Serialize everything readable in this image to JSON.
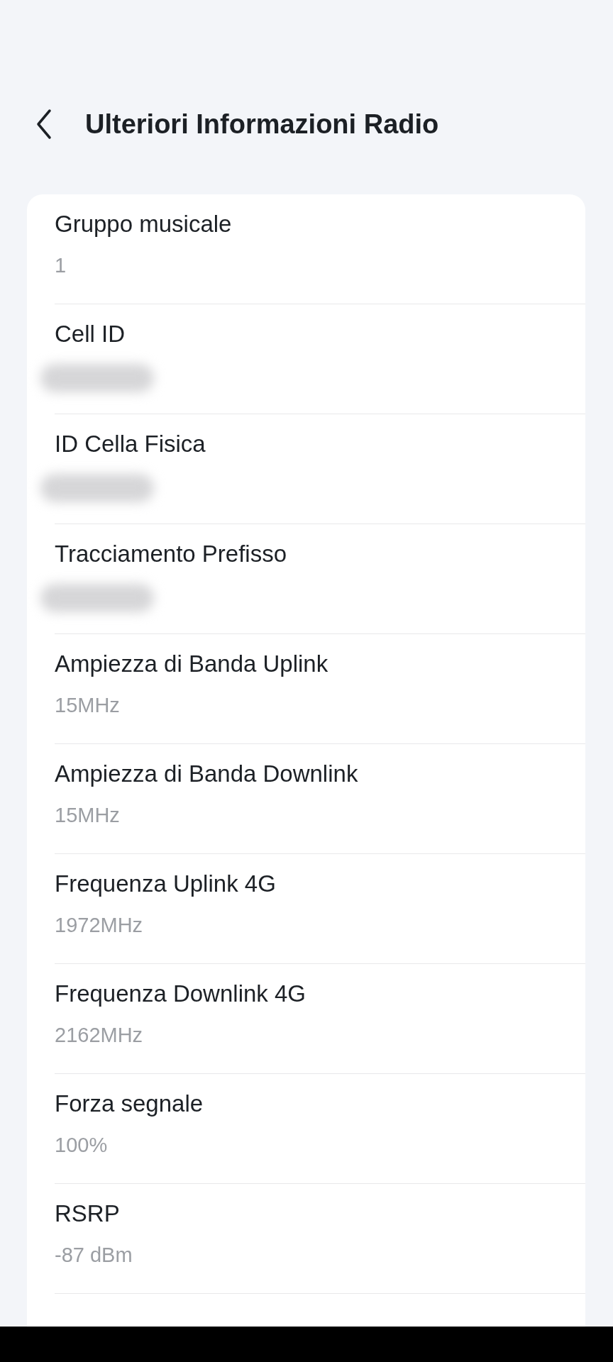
{
  "header": {
    "title": "Ulteriori Informazioni Radio"
  },
  "rows": [
    {
      "label": "Gruppo musicale",
      "value": "1",
      "blurred": false
    },
    {
      "label": "Cell ID",
      "blurred": true
    },
    {
      "label": "ID Cella Fisica",
      "blurred": true
    },
    {
      "label": "Tracciamento Prefisso",
      "blurred": true
    },
    {
      "label": "Ampiezza di Banda Uplink",
      "value": "15MHz",
      "blurred": false
    },
    {
      "label": "Ampiezza di Banda Downlink",
      "value": "15MHz",
      "blurred": false
    },
    {
      "label": "Frequenza Uplink 4G",
      "value": "1972MHz",
      "blurred": false
    },
    {
      "label": "Frequenza Downlink 4G",
      "value": "2162MHz",
      "blurred": false
    },
    {
      "label": "Forza segnale",
      "value": "100%",
      "blurred": false
    },
    {
      "label": "RSRP",
      "value": "-87 dBm",
      "blurred": false
    }
  ]
}
